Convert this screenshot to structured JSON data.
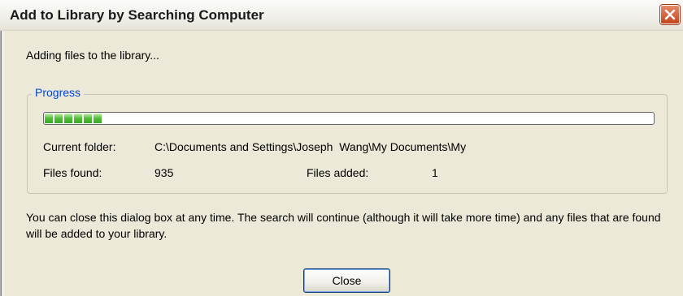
{
  "window": {
    "title": "Add to Library by Searching Computer",
    "close_icon": "close-x-icon"
  },
  "status_text": "Adding files to the library...",
  "progress_group": {
    "legend": "Progress",
    "progress_fraction": 0.09,
    "progress_chunks": 6,
    "current_folder_label": "Current folder:",
    "current_folder_value": "C:\\Documents and Settings\\Joseph  Wang\\My Documents\\My",
    "files_found_label": "Files found:",
    "files_found_value": "935",
    "files_added_label": "Files added:",
    "files_added_value": "1"
  },
  "info_text": "You can close this dialog box at any time. The search will continue (although it will take more time) and any files that are found will be added to your library.",
  "buttons": {
    "close_label": "Close"
  },
  "colors": {
    "accent": "#0046d5",
    "progress": "#4fbd35",
    "close_button": "#c4441f"
  }
}
